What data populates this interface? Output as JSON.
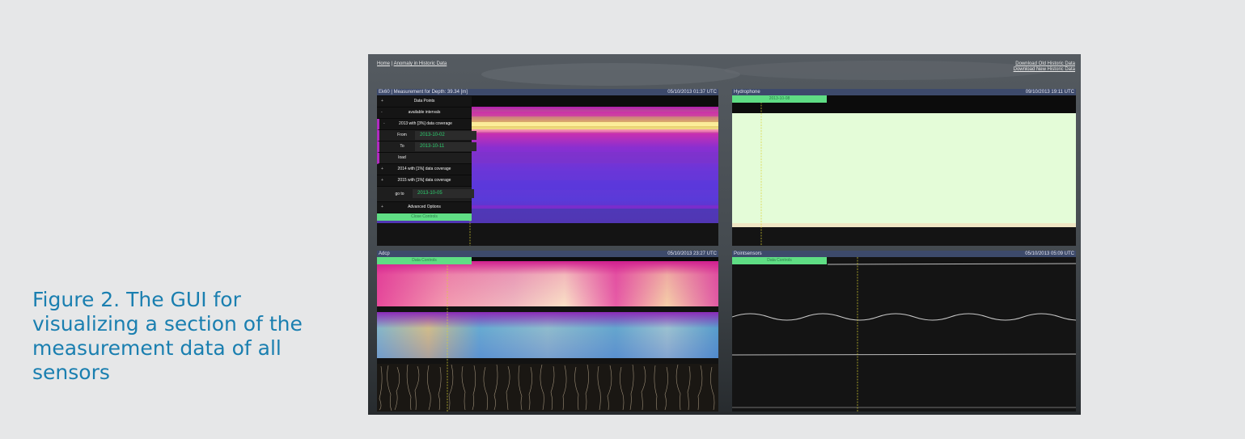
{
  "caption": "Figure 2. The GUI for visualizing a section of the measurement data of all sensors",
  "breadcrumb": {
    "home": "Home",
    "separator": " | ",
    "current": "Anomaly in Historic Data"
  },
  "downloads": {
    "old": "Download Old Historic Data",
    "new": "Download New Historic Data"
  },
  "panels": {
    "ek60": {
      "title": "Ek60 | Measurement for Depth: 39.34 [m]",
      "timestamp": "05/10/2013 01:37 UTC"
    },
    "hydrophone": {
      "title": "Hydrophone",
      "timestamp": "09/10/2013 19:11 UTC",
      "button": "2013-10-08"
    },
    "adcp": {
      "title": "Adcp",
      "timestamp": "05/10/2013 23:27 UTC",
      "button": "Data Controls"
    },
    "pointsensors": {
      "title": "Pointsensors",
      "timestamp": "05/10/2013 05:09 UTC",
      "button": "Data Controls"
    }
  },
  "menu": {
    "data_points": "Data Points",
    "available_intervals": "available intervals",
    "y2013": "2013 with [3%] data coverage",
    "from_label": "From",
    "from_value": "2013-10-02",
    "to_label": "To",
    "to_value": "2013-10-11",
    "load": "load",
    "y2014": "2014 with [1%] data coverage",
    "y2015": "2015 with [1%] data coverage",
    "goto_label": "go to",
    "goto_value": "2013-10-05",
    "advanced": "Advanced Options",
    "close": "Close Controls",
    "toggle_plus": "+",
    "toggle_minus": "-"
  },
  "colors": {
    "caption": "#1a7fb0",
    "title_bar": "#3d4a6b",
    "green": "#5fdd84",
    "value_text": "#2ccf6e"
  }
}
